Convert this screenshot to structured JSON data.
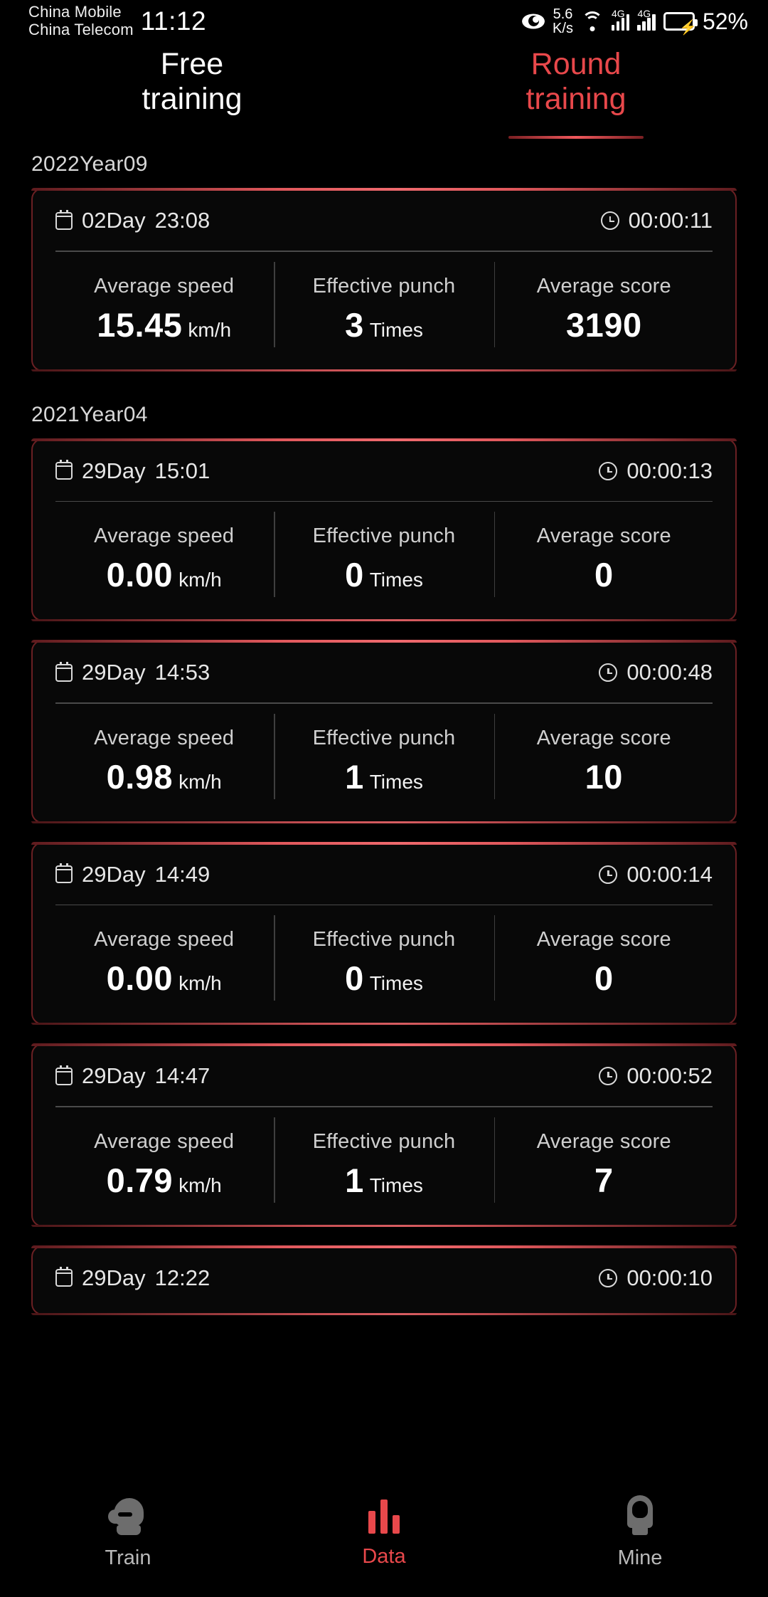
{
  "statusbar": {
    "carrier1": "China Mobile",
    "carrier2": "China Telecom",
    "time": "11:12",
    "eye_icon": "eye-icon",
    "netspeed_value": "5.6",
    "netspeed_unit": "K/s",
    "wifi_icon": "wifi-icon",
    "sim1_network": "4G",
    "sim2_network": "4G",
    "battery_icon": "battery-charging-icon",
    "battery_percent": "52%"
  },
  "tabs": [
    {
      "label": "Free training",
      "active": false
    },
    {
      "label": "Round training",
      "active": true
    }
  ],
  "colors": {
    "accent": "#e8484b",
    "card_border": "#6a2023",
    "background": "#000000",
    "text_primary": "#ffffff",
    "text_secondary": "#cfcfcf"
  },
  "metric_labels": {
    "speed": "Average speed",
    "punch": "Effective punch",
    "score": "Average score",
    "speed_unit": "km/h",
    "punch_unit": "Times",
    "score_unit": ""
  },
  "groups": [
    {
      "date_header": "2022Year09",
      "sessions": [
        {
          "day": "02Day",
          "time": "23:08",
          "duration": "00:00:11",
          "speed": "15.45",
          "punch": "3",
          "score": "3190"
        }
      ]
    },
    {
      "date_header": "2021Year04",
      "sessions": [
        {
          "day": "29Day",
          "time": "15:01",
          "duration": "00:00:13",
          "speed": "0.00",
          "punch": "0",
          "score": "0"
        },
        {
          "day": "29Day",
          "time": "14:53",
          "duration": "00:00:48",
          "speed": "0.98",
          "punch": "1",
          "score": "10"
        },
        {
          "day": "29Day",
          "time": "14:49",
          "duration": "00:00:14",
          "speed": "0.00",
          "punch": "0",
          "score": "0"
        },
        {
          "day": "29Day",
          "time": "14:47",
          "duration": "00:00:52",
          "speed": "0.79",
          "punch": "1",
          "score": "7"
        },
        {
          "day": "29Day",
          "time": "12:22",
          "duration": "00:00:10",
          "speed": "",
          "punch": "",
          "score": ""
        }
      ]
    }
  ],
  "bottomnav": [
    {
      "label": "Train",
      "icon": "boxing-glove-icon",
      "active": false
    },
    {
      "label": "Data",
      "icon": "bar-chart-icon",
      "active": true
    },
    {
      "label": "Mine",
      "icon": "person-icon",
      "active": false
    }
  ]
}
